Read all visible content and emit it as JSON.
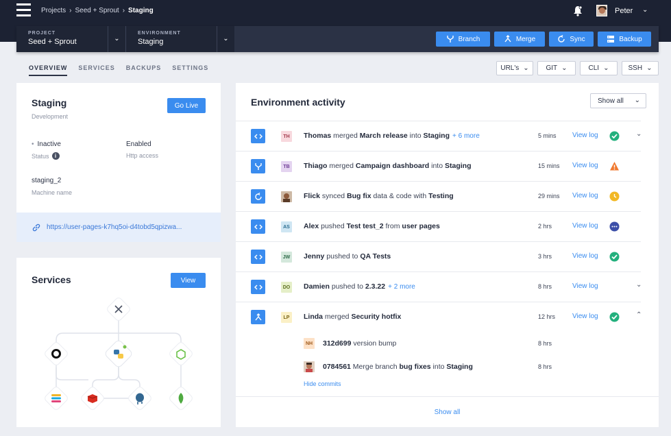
{
  "header": {
    "breadcrumbs": [
      "Projects",
      "Seed + Sprout",
      "Staging"
    ],
    "user_name": "Peter"
  },
  "context": {
    "project_label": "PROJECT",
    "project_value": "Seed + Sprout",
    "environment_label": "ENVIRONMENT",
    "environment_value": "Staging",
    "buttons": {
      "branch": "Branch",
      "merge": "Merge",
      "sync": "Sync",
      "backup": "Backup"
    }
  },
  "subnav": {
    "tabs": [
      "OVERVIEW",
      "SERVICES",
      "BACKUPS",
      "SETTINGS"
    ],
    "tools": [
      "URL's",
      "GIT",
      "CLI",
      "SSH"
    ]
  },
  "environment_card": {
    "title": "Staging",
    "subtitle": "Development",
    "go_live": "Go Live",
    "status_value": "Inactive",
    "status_label": "Status",
    "http_value": "Enabled",
    "http_label": "Http access",
    "machine_value": "staging_2",
    "machine_label": "Machine name",
    "url": "https://user-pages-k7hq5oi-d4tobd5qpizwa..."
  },
  "services_card": {
    "title": "Services",
    "view": "View"
  },
  "activity": {
    "title": "Environment activity",
    "filter": "Show all",
    "view_log": "View log",
    "rows": [
      {
        "initials": "TH",
        "user": "Thomas",
        "verb": " merged ",
        "obj": "March release",
        "mid": " into ",
        "target": "Staging",
        "more": "+ 6 more",
        "time": "5 mins",
        "status": "success"
      },
      {
        "initials": "TB",
        "user": "Thiago",
        "verb": " merged ",
        "obj": "Campaign dashboard",
        "mid": " into ",
        "target": "Staging",
        "more": "",
        "time": "15 mins",
        "status": "warning"
      },
      {
        "initials": "",
        "user": "Flick",
        "verb": " synced ",
        "obj": "Bug fix",
        "mid": " data & code with ",
        "target": "Testing",
        "more": "",
        "time": "29 mins",
        "status": "pending"
      },
      {
        "initials": "AS",
        "user": "Alex",
        "verb": " pushed ",
        "obj": "Test test_2",
        "mid": " from ",
        "target": "user pages",
        "more": "",
        "time": "2 hrs",
        "status": "running"
      },
      {
        "initials": "JW",
        "user": "Jenny",
        "verb": " pushed to ",
        "obj": "QA Tests",
        "mid": "",
        "target": "",
        "more": "",
        "time": "3 hrs",
        "status": "success"
      },
      {
        "initials": "DO",
        "user": "Damien",
        "verb": " pushed to ",
        "obj": "2.3.22",
        "mid": "",
        "target": "",
        "more": "+ 2 more",
        "time": "8 hrs",
        "status": ""
      },
      {
        "initials": "LP",
        "user": "Linda",
        "verb": " merged ",
        "obj": "Security hotfix",
        "mid": "",
        "target": "",
        "more": "",
        "time": "12 hrs",
        "status": "success"
      }
    ],
    "commits": [
      {
        "initials": "NH",
        "hash": "312d699",
        "msg_pre": " version bump",
        "bold": "",
        "msg_mid": "",
        "target": "",
        "time": "8 hrs"
      },
      {
        "initials": "",
        "hash": "0784561",
        "msg_pre": " Merge branch ",
        "bold": "bug fixes",
        "msg_mid": " into ",
        "target": "Staging",
        "time": "8 hrs"
      }
    ],
    "hide_commits": "Hide commits",
    "show_all": "Show all"
  }
}
